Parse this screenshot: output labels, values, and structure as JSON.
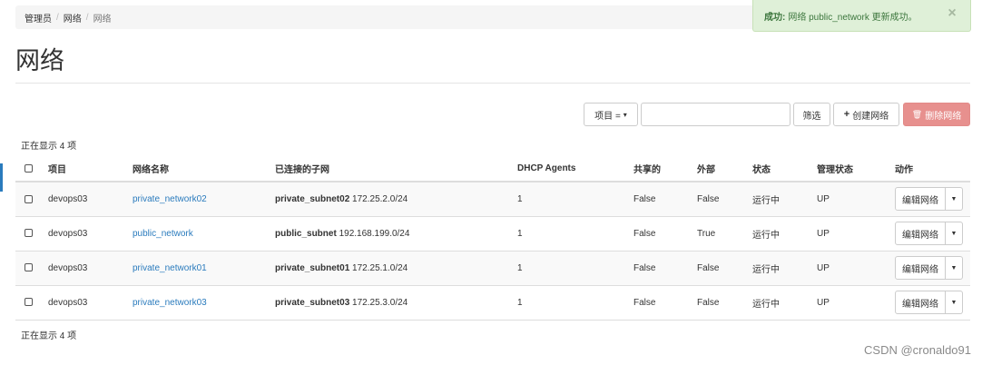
{
  "breadcrumb": {
    "items": [
      "管理员",
      "网络",
      "网络"
    ]
  },
  "alert": {
    "strong": "成功:",
    "message": "网络 public_network 更新成功。",
    "close": "×"
  },
  "page_title": "网络",
  "toolbar": {
    "filter_field_label": "项目 =",
    "filter_field_caret": "▾",
    "filter_input_value": "",
    "filter_button": "筛选",
    "create_icon": "+",
    "create_button": "创建网络",
    "delete_icon": "🗑",
    "delete_button": "删除网络"
  },
  "count_text": "正在显示 4 项",
  "table": {
    "headers": [
      "项目",
      "网络名称",
      "已连接的子网",
      "DHCP Agents",
      "共享的",
      "外部",
      "状态",
      "管理状态",
      "动作"
    ],
    "rows": [
      {
        "project": "devops03",
        "name": "private_network02",
        "subnet_name": "private_subnet02",
        "subnet_cidr": "172.25.2.0/24",
        "dhcp": "1",
        "shared": "False",
        "external": "False",
        "status": "运行中",
        "admin_state": "UP",
        "action": "编辑网络"
      },
      {
        "project": "devops03",
        "name": "public_network",
        "subnet_name": "public_subnet",
        "subnet_cidr": "192.168.199.0/24",
        "dhcp": "1",
        "shared": "False",
        "external": "True",
        "status": "运行中",
        "admin_state": "UP",
        "action": "编辑网络"
      },
      {
        "project": "devops03",
        "name": "private_network01",
        "subnet_name": "private_subnet01",
        "subnet_cidr": "172.25.1.0/24",
        "dhcp": "1",
        "shared": "False",
        "external": "False",
        "status": "运行中",
        "admin_state": "UP",
        "action": "编辑网络"
      },
      {
        "project": "devops03",
        "name": "private_network03",
        "subnet_name": "private_subnet03",
        "subnet_cidr": "172.25.3.0/24",
        "dhcp": "1",
        "shared": "False",
        "external": "False",
        "status": "运行中",
        "admin_state": "UP",
        "action": "编辑网络"
      }
    ],
    "dropdown_caret": "▼"
  },
  "watermark": "CSDN @cronaldo91",
  "colors": {
    "link": "#2a7bbd",
    "success_bg": "#dff0d8",
    "success_text": "#3c763d",
    "danger_disabled": "#e7908e"
  }
}
